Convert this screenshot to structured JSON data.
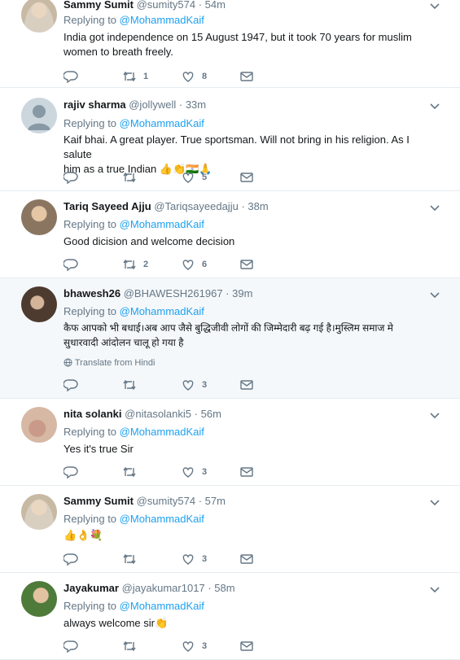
{
  "tweets": [
    {
      "name": "Sammy Sumit",
      "handle": "@sumity574",
      "time": "54m",
      "replying_prefix": "Replying to",
      "replying_to": "@MohammadKaif",
      "text_line1": "India got independence on 15 August 1947, but  it took 70 years for muslim",
      "text_line2": "women to breath freely.",
      "retweets": "1",
      "likes": "8"
    },
    {
      "name": "rajiv sharma",
      "handle": "@jollywell",
      "time": "33m",
      "replying_prefix": "Replying to",
      "replying_to": "@MohammadKaif",
      "text_line1": "Kaif bhai. A great player. True sportsman. Will not bring in his religion. As I salute",
      "text_line2": "him as a true Indian ",
      "emoji": "👍👏🇮🇳🙏",
      "retweets": "",
      "likes": "5"
    },
    {
      "name": "Tariq Sayeed Ajju",
      "handle": "@Tariqsayeedajju",
      "time": "38m",
      "replying_prefix": "Replying to",
      "replying_to": "@MohammadKaif",
      "text_line1": "Good dicision and welcome decision",
      "retweets": "2",
      "likes": "6"
    },
    {
      "name": "bhawesh26",
      "handle": "@BHAWESH261967",
      "time": "39m",
      "replying_prefix": "Replying to",
      "replying_to": "@MohammadKaif",
      "text_line1": "कैफ आपको भी बधाई।अब आप जैसे बुद्धिजीवी लोगों की जिम्मेदारी बढ़ गई है।मुस्लिम समाज मे",
      "text_line2": "सुधारवादी आंदोलन चालू हो गया है",
      "translate": "Translate from Hindi",
      "retweets": "",
      "likes": "3"
    },
    {
      "name": "nita solanki",
      "handle": "@nitasolanki5",
      "time": "56m",
      "replying_prefix": "Replying to",
      "replying_to": "@MohammadKaif",
      "text_line1": "Yes it's true Sir",
      "retweets": "",
      "likes": "3"
    },
    {
      "name": "Sammy Sumit",
      "handle": "@sumity574",
      "time": "57m",
      "replying_prefix": "Replying to",
      "replying_to": "@MohammadKaif",
      "emoji": "👍👌💐",
      "retweets": "",
      "likes": "3"
    },
    {
      "name": "Jayakumar",
      "handle": "@jayakumar1017",
      "time": "58m",
      "replying_prefix": "Replying to",
      "replying_to": "@MohammadKaif",
      "text_line1": "always welcome sir",
      "emoji": "👏",
      "retweets": "",
      "likes": "3"
    }
  ],
  "separator": "·",
  "colors": {
    "link": "#1da1f2",
    "secondary": "#657786",
    "border": "#e6ecf0",
    "highlight_bg": "#f5f8fa"
  },
  "icons": [
    "reply-icon",
    "retweet-icon",
    "like-icon",
    "direct-message-icon",
    "chevron-down-icon",
    "globe-icon"
  ]
}
